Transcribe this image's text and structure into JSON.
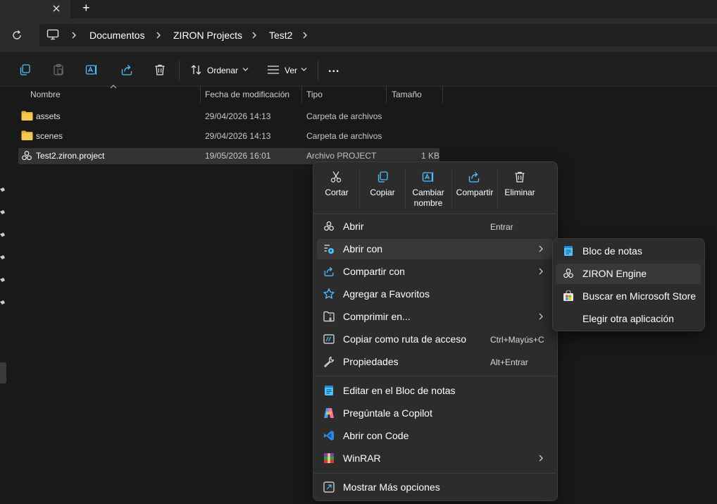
{
  "window": {
    "new_tab_label": "+"
  },
  "breadcrumb": [
    "Documentos",
    "ZIRON Projects",
    "Test2"
  ],
  "commandbar": {
    "sort_label": "Ordenar",
    "view_label": "Ver",
    "more_label": "..."
  },
  "columns": {
    "name": "Nombre",
    "modified": "Fecha de modificación",
    "type": "Tipo",
    "size": "Tamaño"
  },
  "files": [
    {
      "name": "assets",
      "modified": "29/04/2026 14:13",
      "type": "Carpeta de archivos",
      "size": ""
    },
    {
      "name": "scenes",
      "modified": "29/04/2026 14:13",
      "type": "Carpeta de archivos",
      "size": ""
    },
    {
      "name": "Test2.ziron.project",
      "modified": "19/05/2026 16:01",
      "type": "Archivo PROJECT",
      "size": "1 KB"
    }
  ],
  "context_menu": {
    "quick_actions": [
      {
        "label": "Cortar",
        "icon": "scissors-icon"
      },
      {
        "label": "Copiar",
        "icon": "copy-icon"
      },
      {
        "label": "Cambiar nombre",
        "icon": "rename-icon"
      },
      {
        "label": "Compartir",
        "icon": "share-icon"
      },
      {
        "label": "Eliminar",
        "icon": "trash-icon"
      }
    ],
    "items": [
      {
        "label": "Abrir",
        "shortcut": "Entrar",
        "icon": "ziron-icon"
      },
      {
        "label": "Abrir con",
        "shortcut": "",
        "icon": "open-with-icon"
      },
      {
        "label": "Compartir con",
        "shortcut": "",
        "icon": "share-icon"
      },
      {
        "label": "Agregar a Favoritos",
        "shortcut": "",
        "icon": "star-icon"
      },
      {
        "label": "Comprimir en...",
        "shortcut": "",
        "icon": "compress-icon"
      },
      {
        "label": "Copiar como ruta de acceso",
        "shortcut": "Ctrl+Mayús+C",
        "icon": "path-icon"
      },
      {
        "label": "Propiedades",
        "shortcut": "Alt+Entrar",
        "icon": "wrench-icon"
      },
      {
        "label": "Editar en el Bloc de notas",
        "shortcut": "",
        "icon": "notepad-icon"
      },
      {
        "label": "Pregúntale a Copilot",
        "shortcut": "",
        "icon": "copilot-icon"
      },
      {
        "label": "Abrir con Code",
        "shortcut": "",
        "icon": "vscode-icon"
      },
      {
        "label": "WinRAR",
        "shortcut": "",
        "icon": "winrar-icon"
      },
      {
        "label": "Mostrar Más opciones",
        "shortcut": "",
        "icon": "more-options-icon"
      }
    ]
  },
  "submenu": {
    "items": [
      {
        "label": "Bloc de notas",
        "icon": "notepad-icon"
      },
      {
        "label": "ZIRON Engine",
        "icon": "ziron-icon"
      },
      {
        "label": "Buscar en Microsoft Store",
        "icon": "store-icon"
      },
      {
        "label": "Elegir otra aplicación",
        "icon": ""
      }
    ]
  },
  "colors": {
    "accent": "#4cc2ff",
    "folder": "#f0c14b",
    "background": "#191919",
    "menu": "#2c2c2c"
  }
}
